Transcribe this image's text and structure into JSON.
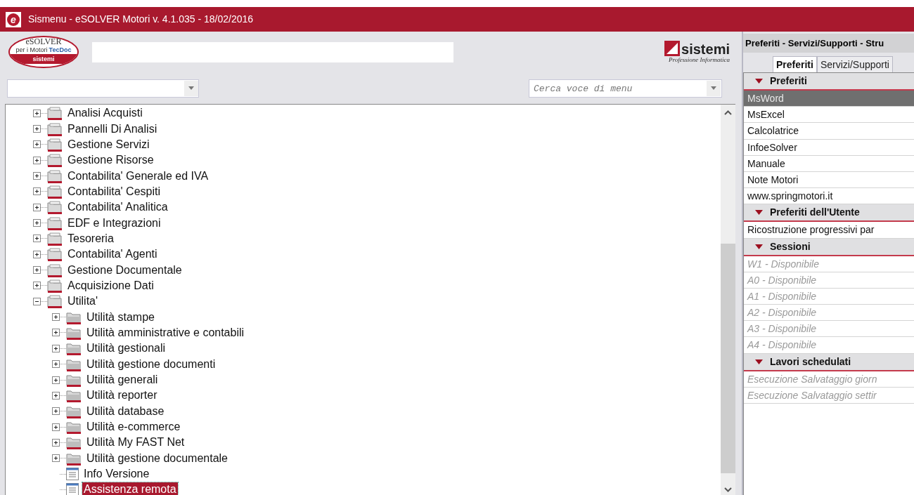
{
  "window": {
    "title": "Sismenu - eSOLVER Motori v. 4.1.035 - 18/02/2016",
    "app_icon_letter": "e"
  },
  "product_logo": {
    "name": "eSOLVER",
    "subtitle": "per i Motori",
    "partner": "TecDoc",
    "brand": "sistemi"
  },
  "company_logo": {
    "name": "sistemi",
    "tagline": "Professione Informatica"
  },
  "menu_search": {
    "placeholder": "Cerca voce di menu"
  },
  "tree": [
    {
      "kind": "folder",
      "label": "Analisi Acquisti",
      "expanded": false,
      "selected": false
    },
    {
      "kind": "folder",
      "label": "Pannelli Di Analisi",
      "expanded": false,
      "selected": false
    },
    {
      "kind": "folder",
      "label": "Gestione Servizi",
      "expanded": false,
      "selected": false
    },
    {
      "kind": "folder",
      "label": "Gestione Risorse",
      "expanded": false,
      "selected": false
    },
    {
      "kind": "folder",
      "label": "Contabilita' Generale ed IVA",
      "expanded": false,
      "selected": false
    },
    {
      "kind": "folder",
      "label": "Contabilita' Cespiti",
      "expanded": false,
      "selected": false
    },
    {
      "kind": "folder",
      "label": "Contabilita' Analitica",
      "expanded": false,
      "selected": false
    },
    {
      "kind": "folder",
      "label": "EDF e Integrazioni",
      "expanded": false,
      "selected": false
    },
    {
      "kind": "folder",
      "label": "Tesoreria",
      "expanded": false,
      "selected": false
    },
    {
      "kind": "folder",
      "label": "Contabilita' Agenti",
      "expanded": false,
      "selected": false
    },
    {
      "kind": "folder",
      "label": "Gestione Documentale",
      "expanded": false,
      "selected": false
    },
    {
      "kind": "folder",
      "label": "Acquisizione Dati",
      "expanded": false,
      "selected": false
    },
    {
      "kind": "folder",
      "label": "Utilita'",
      "expanded": true,
      "selected": false,
      "children": [
        {
          "kind": "folder",
          "label": "Utilità stampe",
          "expanded": false,
          "selected": false
        },
        {
          "kind": "folder",
          "label": "Utilità amministrative e contabili",
          "expanded": false,
          "selected": false
        },
        {
          "kind": "folder",
          "label": "Utilità gestionali",
          "expanded": false,
          "selected": false
        },
        {
          "kind": "folder",
          "label": "Utilità gestione documenti",
          "expanded": false,
          "selected": false
        },
        {
          "kind": "folder",
          "label": "Utilità generali",
          "expanded": false,
          "selected": false
        },
        {
          "kind": "folder",
          "label": "Utilità reporter",
          "expanded": false,
          "selected": false
        },
        {
          "kind": "folder",
          "label": "Utilità database",
          "expanded": false,
          "selected": false
        },
        {
          "kind": "folder",
          "label": "Utilità e-commerce",
          "expanded": false,
          "selected": false
        },
        {
          "kind": "folder",
          "label": "Utilità My FAST Net",
          "expanded": false,
          "selected": false
        },
        {
          "kind": "folder",
          "label": "Utilità gestione documentale",
          "expanded": false,
          "selected": false
        },
        {
          "kind": "document",
          "label": "Info Versione",
          "selected": false
        },
        {
          "kind": "document",
          "label": "Assistenza remota",
          "selected": true
        }
      ]
    }
  ],
  "side_panel": {
    "title": "Preferiti - Servizi/Supporti - Stru",
    "tabs": [
      {
        "label": "Preferiti",
        "selected": true
      },
      {
        "label": "Servizi/Supporti",
        "selected": false
      }
    ],
    "sections": [
      {
        "title": "Preferiti",
        "expanded": true,
        "items": [
          {
            "label": "MsWord",
            "selected": true,
            "disabled": false
          },
          {
            "label": "MsExcel",
            "selected": false,
            "disabled": false
          },
          {
            "label": "Calcolatrice",
            "selected": false,
            "disabled": false
          },
          {
            "label": "InfoeSolver",
            "selected": false,
            "disabled": false
          },
          {
            "label": "Manuale",
            "selected": false,
            "disabled": false
          },
          {
            "label": "Note Motori",
            "selected": false,
            "disabled": false
          },
          {
            "label": "www.springmotori.it",
            "selected": false,
            "disabled": false
          }
        ]
      },
      {
        "title": "Preferiti dell'Utente",
        "expanded": true,
        "items": [
          {
            "label": "Ricostruzione progressivi par",
            "selected": false,
            "disabled": false
          }
        ]
      },
      {
        "title": "Sessioni",
        "expanded": true,
        "items": [
          {
            "label": "W1 - Disponibile",
            "selected": false,
            "disabled": true
          },
          {
            "label": "A0 - Disponibile",
            "selected": false,
            "disabled": true
          },
          {
            "label": "A1 - Disponibile",
            "selected": false,
            "disabled": true
          },
          {
            "label": "A2 - Disponibile",
            "selected": false,
            "disabled": true
          },
          {
            "label": "A3 - Disponibile",
            "selected": false,
            "disabled": true
          },
          {
            "label": "A4 - Disponibile",
            "selected": false,
            "disabled": true
          }
        ]
      },
      {
        "title": "Lavori schedulati",
        "expanded": true,
        "items": [
          {
            "label": "Esecuzione Salvataggio giorn",
            "selected": false,
            "disabled": true
          },
          {
            "label": "Esecuzione Salvataggio settir",
            "selected": false,
            "disabled": true
          }
        ]
      }
    ]
  }
}
